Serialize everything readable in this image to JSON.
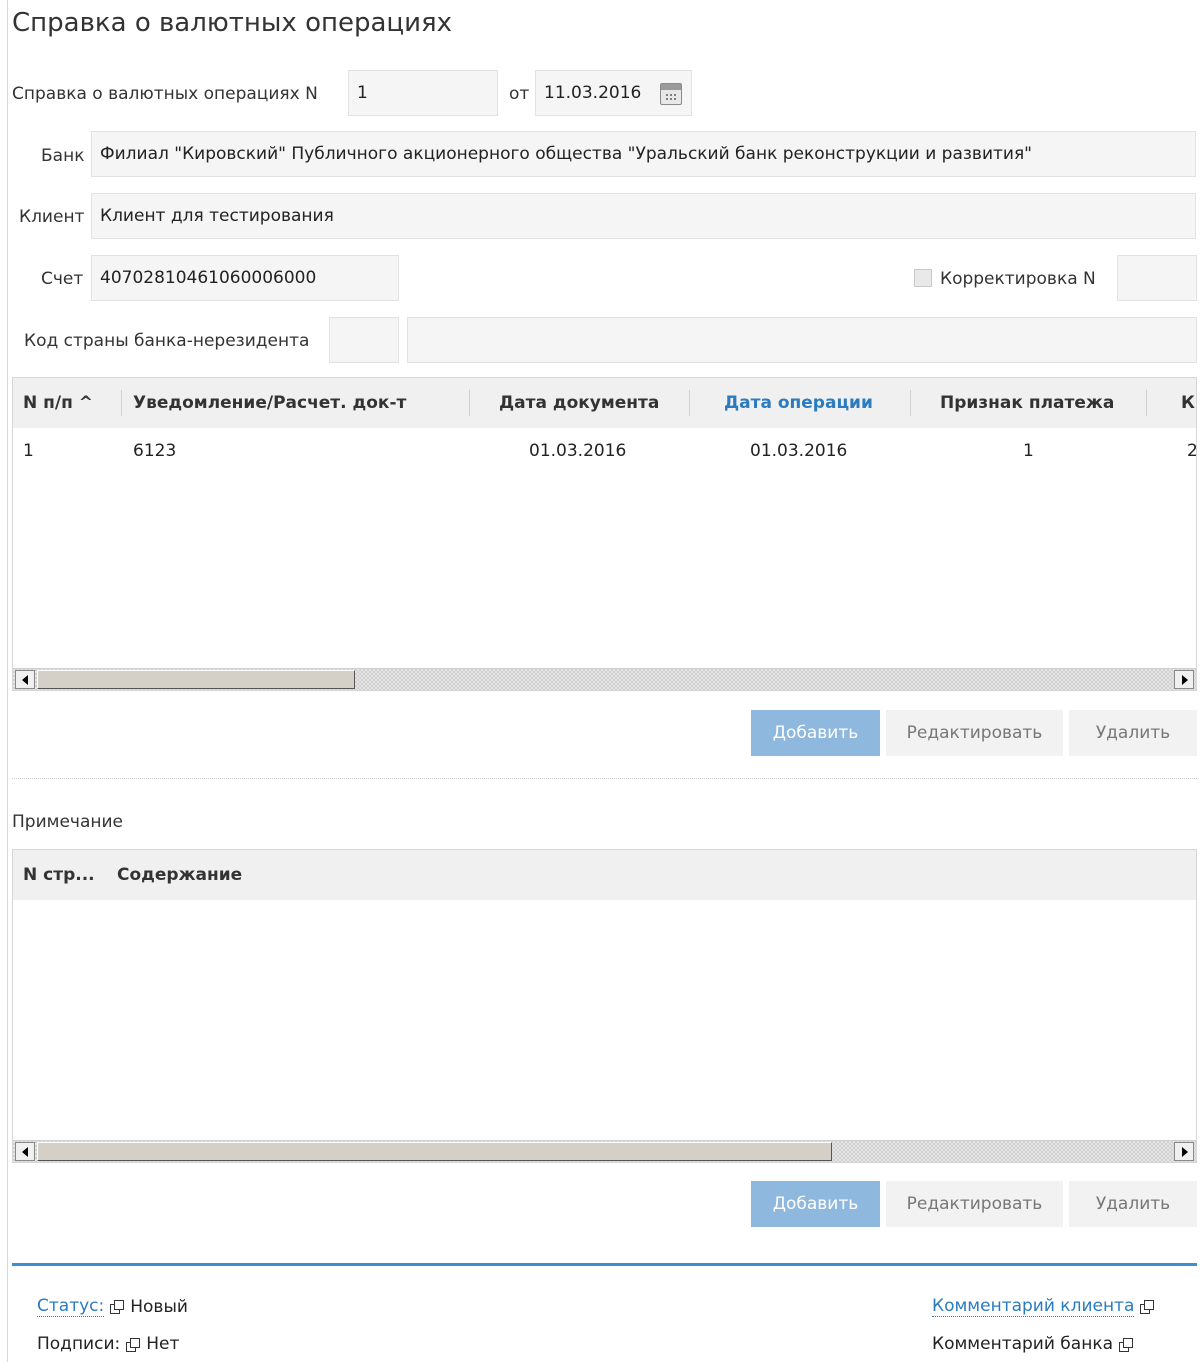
{
  "form": {
    "title": "Справка о валютных операциях",
    "number_label": "Справка о валютных операциях N",
    "number_value": "1",
    "date_label": "от",
    "date_value": "11.03.2016",
    "bank_label": "Банк",
    "bank_value": "Филиал \"Кировский\" Публичного акционерного общества \"Уральский банк реконструкции и развития\"",
    "client_label": "Клиент",
    "client_value": "Клиент для тестирования",
    "account_label": "Счет",
    "account_value": "40702810461060006000",
    "correction_label": "Корректировка N",
    "correction_value": "",
    "country_label": "Код страны банка-нерезидента",
    "country_code": "",
    "country_name": ""
  },
  "operations_table": {
    "columns": [
      "N п/п ^",
      "Уведомление/Расчет. док-т",
      "Дата документа",
      "Дата операции",
      "Признак платежа",
      "К"
    ],
    "rows": [
      {
        "num": "1",
        "doc": "6123",
        "doc_date": "01.03.2016",
        "op_date": "01.03.2016",
        "sign": "1",
        "extra": "2"
      }
    ],
    "scroll_fraction": 0.28
  },
  "operations_buttons": {
    "add": "Добавить",
    "edit": "Редактировать",
    "delete": "Удалить"
  },
  "notes": {
    "label": "Примечание",
    "columns": [
      "N стр...",
      "Содержание"
    ],
    "scroll_fraction": 0.7
  },
  "notes_buttons": {
    "add": "Добавить",
    "edit": "Редактировать",
    "delete": "Удалить"
  },
  "footer": {
    "status_label": "Статус:",
    "status_value": "Новый",
    "signatures_label": "Подписи:",
    "signatures_value": "Нет",
    "client_comment": "Комментарий клиента",
    "bank_comment": "Комментарий банка"
  },
  "colors": {
    "accent": "#3c8fd0",
    "link": "#2a7bc0",
    "primary_button": "#8fb8de"
  },
  "icons": [
    "calendar-icon",
    "external-window-icon",
    "sort-ascending-icon",
    "scroll-left-arrow-icon",
    "scroll-right-arrow-icon"
  ]
}
